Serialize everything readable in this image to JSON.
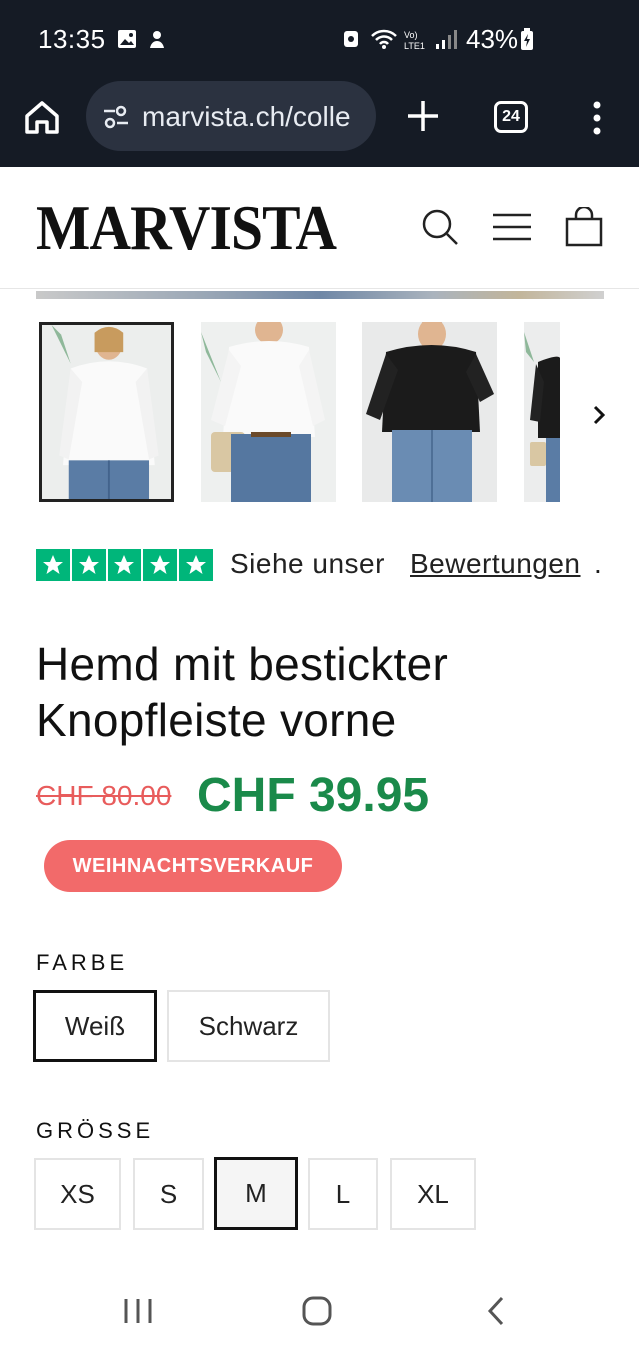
{
  "status_bar": {
    "time": "13:35",
    "battery": "43%"
  },
  "browser": {
    "url": "marvista.ch/colle",
    "tab_count": "24"
  },
  "site": {
    "logo": "MARVISTA"
  },
  "rating": {
    "text": "Siehe unser",
    "link": "Bewertungen",
    "suffix": "."
  },
  "product": {
    "title": "Hemd mit bestickter Knopfleiste vorne",
    "old_price": "CHF 80.00",
    "new_price": "CHF 39.95",
    "badge": "WEIHNACHTSVERKAUF"
  },
  "color_option": {
    "label": "FARBE",
    "values": [
      "Weiß",
      "Schwarz"
    ],
    "selected": "Weiß"
  },
  "size_option": {
    "label": "GRÖSSE",
    "values": [
      "XS",
      "S",
      "M",
      "L",
      "XL"
    ],
    "selected": "M"
  },
  "colors": {
    "sale_green": "#1a8a4a",
    "old_price_red": "#e85c5c",
    "badge_red": "#f26a6a",
    "trustpilot_green": "#00b67a",
    "chrome_dark": "#151b25"
  }
}
